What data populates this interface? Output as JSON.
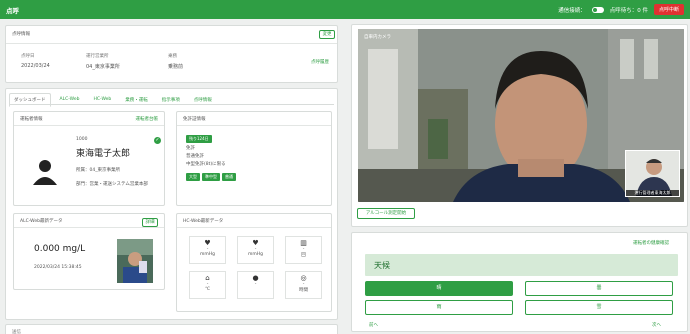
{
  "topbar": {
    "title": "点呼",
    "status_label": "通信接続：",
    "waiting": "点呼待ち：0 件",
    "abort_button": "点呼中断"
  },
  "info": {
    "section_title": "点呼情報",
    "edit_button": "変更",
    "cols": [
      {
        "label": "点呼日",
        "value": "2022/03/24"
      },
      {
        "label": "運行営業所",
        "value": "04_東京事業所"
      },
      {
        "label": "乗務",
        "value": "乗務前"
      }
    ],
    "history_link": "点呼履歴"
  },
  "tabs": [
    "ダッシュボード",
    "ALC-Web",
    "HC-Web",
    "業務・運転",
    "指示事項",
    "点呼情報"
  ],
  "driver": {
    "title": "運転者情報",
    "register_link": "運転者台帳",
    "code": "1000",
    "name": "東海電子太郎",
    "office": "所属：04_東京事業所",
    "dept": "部門：営業・運送システム営業本部"
  },
  "appointment": {
    "title": "免許証情報",
    "date_badge": "残り124日",
    "lines": [
      "免許",
      "普通免許",
      "中型免許(8t)に限る"
    ],
    "tags": [
      "大型",
      "準中型",
      "普通"
    ]
  },
  "alc": {
    "title": "ALC-Web最新データ",
    "detail_button": "詳細",
    "value": "0.000 mg/L",
    "timestamp": "2022/03/24 15:38:45"
  },
  "hc": {
    "title": "HC-Web最新データ",
    "cells": [
      {
        "icon": "♥",
        "value": "-",
        "unit": "mmHg"
      },
      {
        "icon": "♥",
        "value": "-",
        "unit": "mmHg"
      },
      {
        "icon": "▥",
        "value": "-",
        "unit": "回"
      },
      {
        "icon": "⌂",
        "value": "-",
        "unit": "℃"
      },
      {
        "icon": "●",
        "value": "-",
        "unit": ""
      },
      {
        "icon": "◎",
        "value": "-",
        "unit": "時間"
      }
    ]
  },
  "video": {
    "camera_label": "自車内カメラ",
    "pip_label": "運行管理者東海太郎",
    "start_button": "アルコール測定開始"
  },
  "weather": {
    "link": "運転者の健康確認",
    "title": "天候",
    "options": [
      "晴",
      "曇",
      "雨",
      "雪"
    ],
    "selected": "晴",
    "prev": "前へ",
    "next": "次へ"
  },
  "bottom": {
    "label": "送信"
  }
}
